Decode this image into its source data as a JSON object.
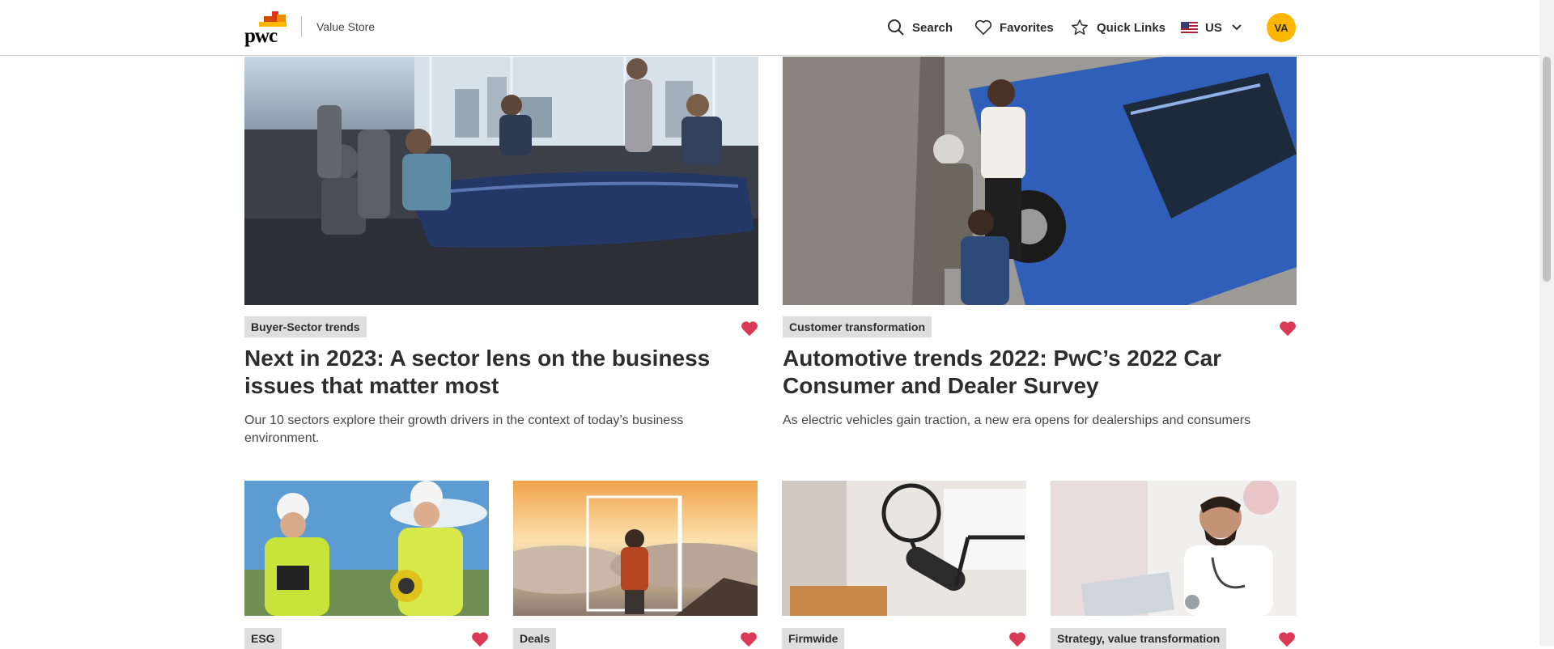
{
  "header": {
    "logo_text": "pwc",
    "store_name": "Value Store",
    "nav": {
      "search_label": "Search",
      "favorites_label": "Favorites",
      "quick_links_label": "Quick Links",
      "region_label": "US"
    },
    "avatar_initials": "VA"
  },
  "featured_cards": [
    {
      "tag": "Buyer-Sector trends",
      "title": "Next in 2023: A sector lens on the business issues that matter most",
      "description": "Our 10 sectors explore their growth drivers in the context of today’s business environment.",
      "favorited": true,
      "image_icon": "meeting-room-image"
    },
    {
      "tag": "Customer transformation",
      "title": "Automotive trends 2022: PwC’s 2022 Car Consumer and Dealer Survey",
      "description": "As electric vehicles gain traction, a new era opens for dealerships and consumers",
      "favorited": true,
      "image_icon": "car-dealership-image"
    }
  ],
  "small_cards": [
    {
      "tag": "ESG",
      "favorited": true,
      "image_icon": "field-engineers-image"
    },
    {
      "tag": "Deals",
      "favorited": true,
      "image_icon": "sunset-clouds-image"
    },
    {
      "tag": "Firmwide",
      "favorited": true,
      "image_icon": "microphone-image"
    },
    {
      "tag": "Strategy, value transformation",
      "favorited": true,
      "image_icon": "doctor-image"
    }
  ],
  "colors": {
    "heart": "#d93954",
    "avatar": "#ffb600",
    "tag_bg": "#dedede",
    "text": "#2d2d2d"
  }
}
